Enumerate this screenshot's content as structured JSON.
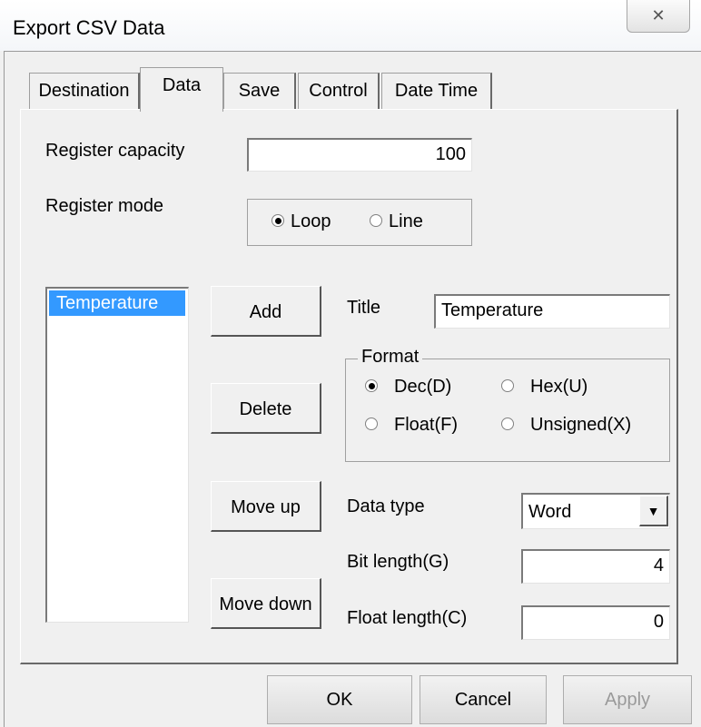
{
  "window": {
    "title": "Export CSV Data",
    "close_glyph": "✕"
  },
  "tabs": [
    {
      "label": "Destination",
      "active": false
    },
    {
      "label": "Data",
      "active": true
    },
    {
      "label": "Save",
      "active": false
    },
    {
      "label": "Control",
      "active": false
    },
    {
      "label": "Date Time",
      "active": false
    }
  ],
  "register": {
    "capacity_label": "Register capacity",
    "capacity_value": "100",
    "mode_label": "Register mode",
    "mode_options": [
      "Loop",
      "Line"
    ],
    "mode_selected": "Loop"
  },
  "data_list": {
    "items": [
      "Temperature"
    ],
    "selected": "Temperature"
  },
  "buttons": {
    "add": "Add",
    "delete": "Delete",
    "move_up": "Move up",
    "move_down": "Move down"
  },
  "item_settings": {
    "title_label": "Title",
    "title_value": "Temperature",
    "format_label": "Format",
    "format_options": [
      "Dec(D)",
      "Hex(U)",
      "Float(F)",
      "Unsigned(X)"
    ],
    "format_selected": "Dec(D)",
    "data_type_label": "Data type",
    "data_type_value": "Word",
    "bit_length_label": "Bit length(G)",
    "bit_length_value": "4",
    "float_length_label": "Float length(C)",
    "float_length_value": "0"
  },
  "footer": {
    "ok": "OK",
    "cancel": "Cancel",
    "apply": "Apply",
    "apply_enabled": false
  },
  "colors": {
    "selection": "#3399ff",
    "dialog_bg": "#f0f0f0"
  }
}
